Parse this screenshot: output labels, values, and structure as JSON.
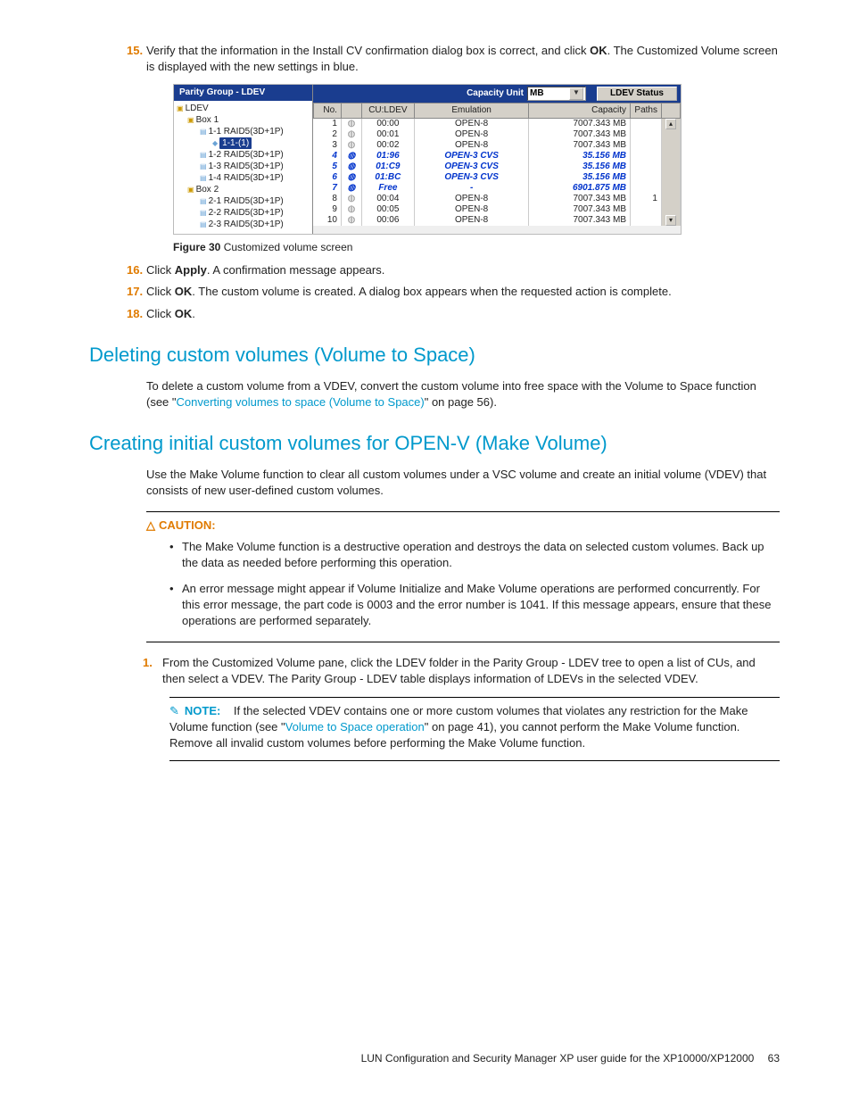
{
  "steps_top": {
    "s15": {
      "num": "15.",
      "pre": "Verify that the information in the Install CV confirmation dialog box is correct, and click ",
      "bold": "OK",
      "post": ". The Customized Volume screen is displayed with the new settings in blue."
    },
    "s16": {
      "num": "16.",
      "pre": "Click ",
      "bold": "Apply",
      "post": ". A confirmation message appears."
    },
    "s17": {
      "num": "17.",
      "pre": "Click ",
      "bold": "OK",
      "post": ". The custom volume is created. A dialog box appears when the requested action is complete."
    },
    "s18": {
      "num": "18.",
      "pre": "Click ",
      "bold": "OK",
      "post": "."
    }
  },
  "figure": {
    "label": "Figure 30",
    "caption": "Customized volume screen"
  },
  "screenshot": {
    "tree_title": "Parity Group - LDEV",
    "capacity_label": "Capacity Unit",
    "capacity_value": "MB",
    "ldev_status": "LDEV Status",
    "tree": {
      "root": "LDEV",
      "box1": "Box 1",
      "b1_items": [
        "1-1 RAID5(3D+1P)",
        "1-2 RAID5(3D+1P)",
        "1-3 RAID5(3D+1P)",
        "1-4 RAID5(3D+1P)"
      ],
      "selected": "1-1-(1)",
      "box2": "Box 2",
      "b2_items": [
        "2-1 RAID5(3D+1P)",
        "2-2 RAID5(3D+1P)",
        "2-3 RAID5(3D+1P)"
      ]
    },
    "columns": {
      "no": "No.",
      "cu": "CU:LDEV",
      "emu": "Emulation",
      "cap": "Capacity",
      "paths": "Paths"
    },
    "rows": [
      {
        "no": "1",
        "cu": "00:00",
        "emu": "OPEN-8",
        "cap": "7007.343 MB",
        "paths": "",
        "blue": false
      },
      {
        "no": "2",
        "cu": "00:01",
        "emu": "OPEN-8",
        "cap": "7007.343 MB",
        "paths": "",
        "blue": false
      },
      {
        "no": "3",
        "cu": "00:02",
        "emu": "OPEN-8",
        "cap": "7007.343 MB",
        "paths": "",
        "blue": false
      },
      {
        "no": "4",
        "cu": "01:96",
        "emu": "OPEN-3 CVS",
        "cap": "35.156 MB",
        "paths": "",
        "blue": true
      },
      {
        "no": "5",
        "cu": "01:C9",
        "emu": "OPEN-3 CVS",
        "cap": "35.156 MB",
        "paths": "",
        "blue": true
      },
      {
        "no": "6",
        "cu": "01:BC",
        "emu": "OPEN-3 CVS",
        "cap": "35.156 MB",
        "paths": "",
        "blue": true
      },
      {
        "no": "7",
        "cu": "Free",
        "emu": "-",
        "cap": "6901.875 MB",
        "paths": "",
        "blue": true
      },
      {
        "no": "8",
        "cu": "00:04",
        "emu": "OPEN-8",
        "cap": "7007.343 MB",
        "paths": "1",
        "blue": false
      },
      {
        "no": "9",
        "cu": "00:05",
        "emu": "OPEN-8",
        "cap": "7007.343 MB",
        "paths": "",
        "blue": false
      },
      {
        "no": "10",
        "cu": "00:06",
        "emu": "OPEN-8",
        "cap": "7007.343 MB",
        "paths": "",
        "blue": false
      }
    ]
  },
  "heading1": "Deleting custom volumes (Volume to Space)",
  "para1": {
    "pre": "To delete a custom volume from a VDEV, convert the custom volume into free space with the Volume to Space function (see \"",
    "link": "Converting volumes to space (Volume to Space)",
    "post": "\" on page 56)."
  },
  "heading2": "Creating initial custom volumes for OPEN-V (Make Volume)",
  "para2": "Use the Make Volume function to clear all custom volumes under a VSC volume and create an initial volume (VDEV) that consists of new user-defined custom volumes.",
  "caution": {
    "label": "CAUTION:",
    "bullets": [
      "The Make Volume function is a destructive operation and destroys the data on selected custom volumes. Back up the data as needed before performing this operation.",
      "An error message might appear if Volume Initialize and Make Volume operations are performed concurrently. For this error message, the part code is 0003 and the error number is 1041. If this message appears, ensure that these operations are performed separately."
    ]
  },
  "step1": {
    "num": "1.",
    "text": "From the Customized Volume pane, click the LDEV folder in the Parity Group - LDEV tree to open a list of CUs, and then select a VDEV. The Parity Group - LDEV table displays information of LDEVs in the selected VDEV."
  },
  "note": {
    "label": "NOTE:",
    "pre": "If the selected VDEV contains one or more custom volumes that violates any restriction for the Make Volume function (see \"",
    "link": "Volume to Space operation",
    "post": "\" on page 41), you cannot perform the Make Volume function. Remove all invalid custom volumes before performing the Make Volume function."
  },
  "footer": {
    "text": "LUN Configuration and Security Manager XP user guide for the XP10000/XP12000",
    "page": "63"
  }
}
